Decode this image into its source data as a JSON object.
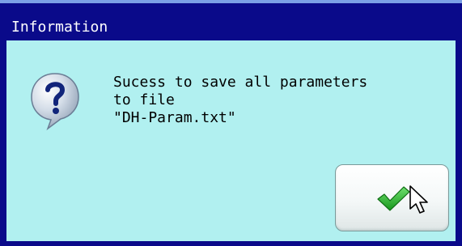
{
  "dialog": {
    "title": "Information",
    "icon": "question-icon",
    "message_lines": [
      "Sucess to save all parameters",
      "to file",
      "\"DH-Param.txt\""
    ]
  },
  "ok_button": {
    "icon": "checkmark-icon"
  },
  "cursor": {
    "icon": "arrow-cursor-icon"
  },
  "colors": {
    "titlebar": "#0a0a8a",
    "titlebar_highlight": "#7ba0e6",
    "dialog_background": "#b1f0f0",
    "title_text": "#ffffff",
    "checkmark": "#2fb82f"
  }
}
